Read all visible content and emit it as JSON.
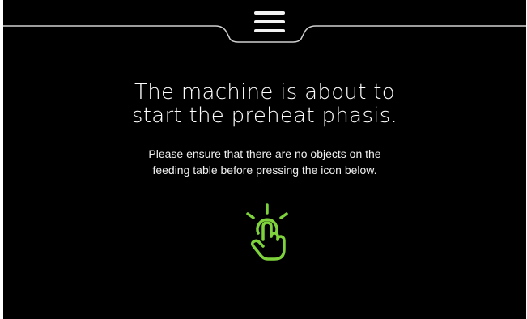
{
  "header": {
    "menu_icon": "hamburger-menu-icon"
  },
  "message": {
    "title_lines": [
      "The machine is about to",
      "start the preheat phasis."
    ],
    "body_lines": [
      "Please ensure that there are no objects on the",
      "feeding table before pressing the icon below."
    ]
  },
  "action": {
    "icon": "touch-hand-icon",
    "accent_color": "#7ed23c"
  },
  "colors": {
    "background": "#000000",
    "text": "#ffffff"
  }
}
